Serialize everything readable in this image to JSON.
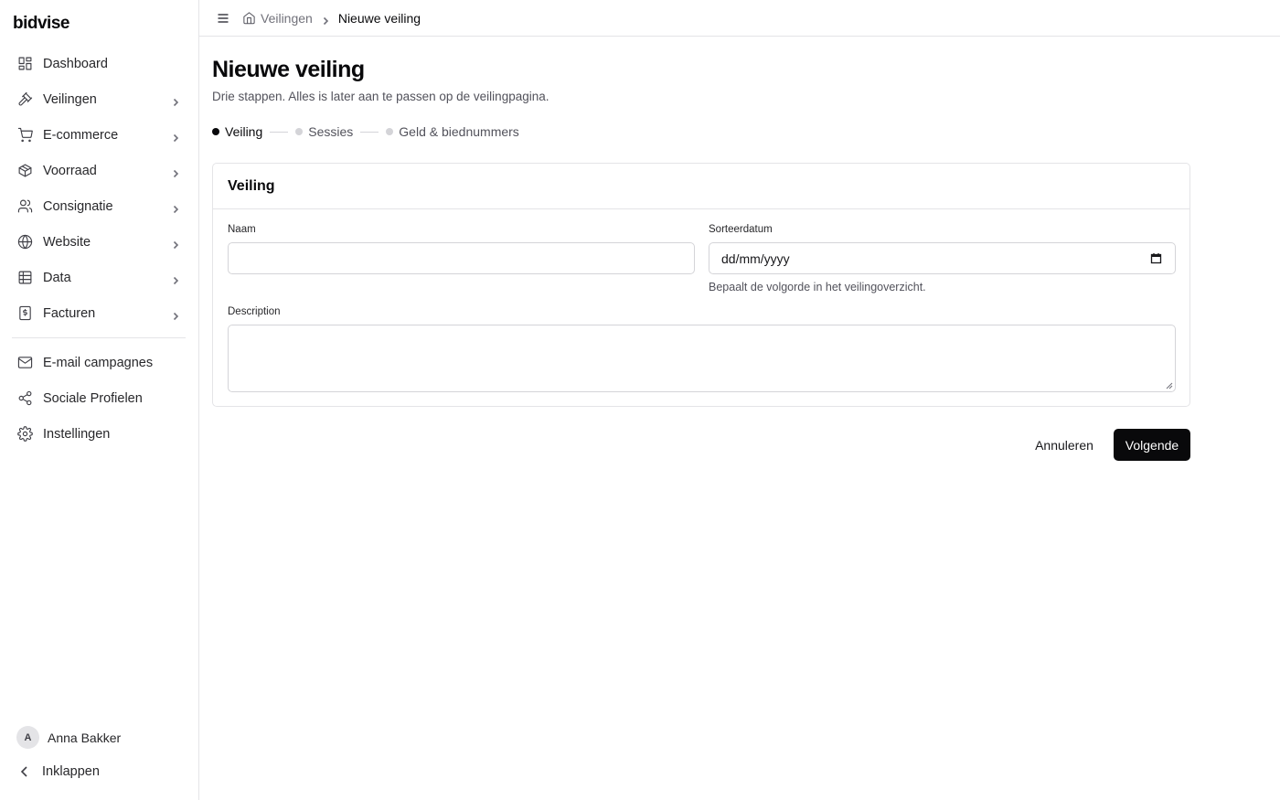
{
  "app": {
    "logo": "bidvise"
  },
  "sidebar": {
    "items": [
      {
        "label": "Dashboard",
        "icon": "dashboard-icon",
        "has_children": false
      },
      {
        "label": "Veilingen",
        "icon": "gavel-icon",
        "has_children": true
      },
      {
        "label": "E-commerce",
        "icon": "cart-icon",
        "has_children": true
      },
      {
        "label": "Voorraad",
        "icon": "package-icon",
        "has_children": true
      },
      {
        "label": "Consignatie",
        "icon": "users-icon",
        "has_children": true
      },
      {
        "label": "Website",
        "icon": "globe-icon",
        "has_children": true
      },
      {
        "label": "Data",
        "icon": "table-icon",
        "has_children": true
      },
      {
        "label": "Facturen",
        "icon": "invoice-icon",
        "has_children": true
      }
    ],
    "secondary": [
      {
        "label": "E-mail campagnes",
        "icon": "mail-icon"
      },
      {
        "label": "Sociale Profielen",
        "icon": "share-icon"
      },
      {
        "label": "Instellingen",
        "icon": "gear-icon"
      }
    ],
    "user": {
      "initial": "A",
      "name": "Anna Bakker"
    },
    "collapse_label": "Inklappen"
  },
  "breadcrumb": {
    "parent": "Veilingen",
    "current": "Nieuwe veiling"
  },
  "page": {
    "title": "Nieuwe veiling",
    "subtitle": "Drie stappen. Alles is later aan te passen op de veilingpagina."
  },
  "steps": [
    {
      "label": "Veiling",
      "active": true
    },
    {
      "label": "Sessies",
      "active": false
    },
    {
      "label": "Geld & biednummers",
      "active": false
    }
  ],
  "form": {
    "card_title": "Veiling",
    "name_label": "Naam",
    "name_value": "",
    "sort_date_label": "Sorteerdatum",
    "sort_date_placeholder": "dd/mm/yyyy",
    "sort_date_hint": "Bepaalt de volgorde in het veilingoverzicht.",
    "description_label": "Description",
    "description_value": ""
  },
  "actions": {
    "cancel": "Annuleren",
    "next": "Volgende"
  },
  "colors": {
    "primary": "#09090b",
    "border": "#e4e4e7",
    "muted": "#52525b"
  }
}
